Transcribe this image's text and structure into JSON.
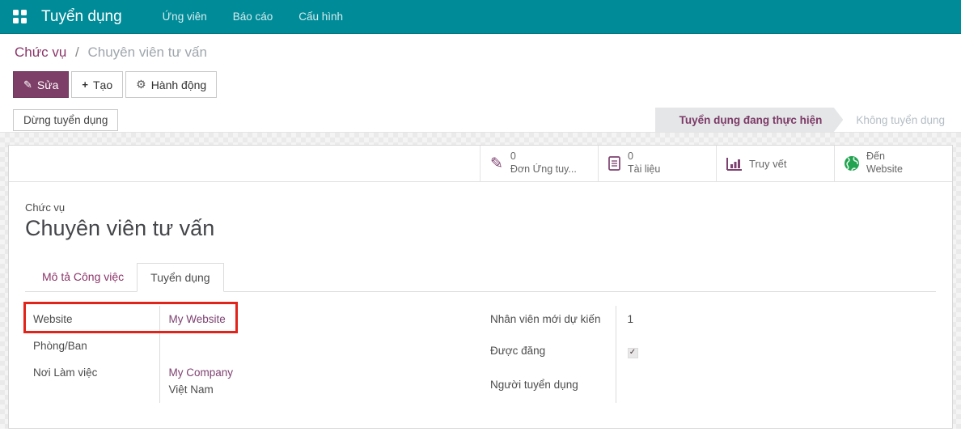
{
  "nav": {
    "app_name": "Tuyển dụng",
    "menu_items": [
      {
        "label": "Ứng viên"
      },
      {
        "label": "Báo cáo"
      },
      {
        "label": "Cấu hình"
      }
    ]
  },
  "breadcrumb": {
    "parent": "Chức vụ",
    "separator": "/",
    "current": "Chuyên viên tư vấn"
  },
  "actions": {
    "edit_label": "Sửa",
    "create_label": "Tạo",
    "action_menu_label": "Hành động"
  },
  "icons": {
    "pencil_glyph": "✎",
    "plus_glyph": "+",
    "gear_glyph": "⚙",
    "check_glyph": "✓"
  },
  "status_bar": {
    "stop_button_label": "Dừng tuyển dụng",
    "stages": [
      {
        "label": "Tuyển dụng đang thực hiện",
        "active": true
      },
      {
        "label": "Không tuyển dụng",
        "active": false
      }
    ]
  },
  "stat_buttons": [
    {
      "icon": "pencil-icon",
      "value": "0",
      "label": "Đơn Ứng tuy..."
    },
    {
      "icon": "document-icon",
      "value": "0",
      "label": "Tài liệu"
    },
    {
      "icon": "chart-icon",
      "label": "Truy vết"
    },
    {
      "icon": "globe-icon",
      "value": "Đến",
      "label": "Website"
    }
  ],
  "sheet": {
    "record_label": "Chức vụ",
    "record_title": "Chuyên viên tư vấn",
    "tabs": [
      {
        "label": "Mô tả Công việc",
        "active": false
      },
      {
        "label": "Tuyển dụng",
        "active": true
      }
    ],
    "left_fields": [
      {
        "label": "Website",
        "value": "My Website",
        "highlighted": true
      },
      {
        "label": "Phòng/Ban",
        "value": ""
      },
      {
        "label": "Nơi Làm việc",
        "value": "My Company",
        "value2": "Việt Nam"
      }
    ],
    "right_fields": [
      {
        "label": "Nhân viên mới dự kiến",
        "value": "1"
      },
      {
        "label": "Được đăng",
        "checked": true
      },
      {
        "label": "Người tuyển dụng",
        "value": ""
      }
    ]
  },
  "colors": {
    "navbar_teal": "#008b99",
    "primary_purple": "#7d3f67",
    "link_purple": "#7d4170",
    "annotation_red": "#e2231a",
    "globe_green": "#21a350",
    "stage_bg": "#e4e6e8"
  }
}
